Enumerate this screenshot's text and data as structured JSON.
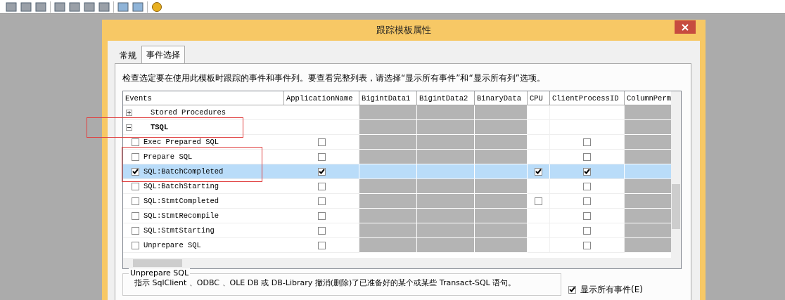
{
  "dialog": {
    "title": "跟踪模板属性"
  },
  "tabs": [
    {
      "label": "常规",
      "selected": false
    },
    {
      "label": "事件选择",
      "selected": true
    }
  ],
  "instructions": "检查选定要在使用此模板时跟踪的事件和事件列。要查看完整列表，请选择“显示所有事件”和“显示所有列”选项。",
  "grid": {
    "columns": [
      {
        "label": "Events"
      },
      {
        "label": "ApplicationName",
        "available": true
      },
      {
        "label": "BigintData1",
        "available": false
      },
      {
        "label": "BigintData2",
        "available": false
      },
      {
        "label": "BinaryData",
        "available": false
      },
      {
        "label": "CPU",
        "available": true
      },
      {
        "label": "ClientProcessID",
        "available": true
      },
      {
        "label": "ColumnPerm",
        "available": false
      }
    ],
    "rows": [
      {
        "kind": "category",
        "label": "Stored Procedures",
        "expanded": false,
        "selected": false,
        "framed": false,
        "cells": []
      },
      {
        "kind": "category",
        "label": "TSQL",
        "expanded": true,
        "selected": false,
        "framed": true,
        "cells": []
      },
      {
        "kind": "event",
        "label": "Exec Prepared SQL",
        "checked": false,
        "selected": false,
        "framed": false,
        "cells": [
          {
            "kind": "checkbox",
            "checked": false
          },
          {
            "kind": "none"
          },
          {
            "kind": "none"
          },
          {
            "kind": "none"
          },
          {
            "kind": "none"
          },
          {
            "kind": "checkbox",
            "checked": false
          },
          {
            "kind": "none"
          }
        ]
      },
      {
        "kind": "event",
        "label": "Prepare SQL",
        "checked": false,
        "selected": false,
        "framed": true,
        "cells": [
          {
            "kind": "checkbox",
            "checked": false
          },
          {
            "kind": "none"
          },
          {
            "kind": "none"
          },
          {
            "kind": "none"
          },
          {
            "kind": "none"
          },
          {
            "kind": "checkbox",
            "checked": false
          },
          {
            "kind": "none"
          }
        ]
      },
      {
        "kind": "event",
        "label": "SQL:BatchCompleted",
        "checked": true,
        "selected": true,
        "framed": true,
        "cells": [
          {
            "kind": "checkbox",
            "checked": true
          },
          {
            "kind": "none"
          },
          {
            "kind": "none"
          },
          {
            "kind": "none"
          },
          {
            "kind": "checkbox",
            "checked": true
          },
          {
            "kind": "checkbox",
            "checked": true
          },
          {
            "kind": "none"
          }
        ]
      },
      {
        "kind": "event",
        "label": "SQL:BatchStarting",
        "checked": false,
        "selected": false,
        "framed": false,
        "cells": [
          {
            "kind": "checkbox",
            "checked": false
          },
          {
            "kind": "none"
          },
          {
            "kind": "none"
          },
          {
            "kind": "none"
          },
          {
            "kind": "none"
          },
          {
            "kind": "checkbox",
            "checked": false
          },
          {
            "kind": "none"
          }
        ]
      },
      {
        "kind": "event",
        "label": "SQL:StmtCompleted",
        "checked": false,
        "selected": false,
        "framed": false,
        "cells": [
          {
            "kind": "checkbox",
            "checked": false
          },
          {
            "kind": "none"
          },
          {
            "kind": "none"
          },
          {
            "kind": "none"
          },
          {
            "kind": "checkbox",
            "checked": false
          },
          {
            "kind": "checkbox",
            "checked": false
          },
          {
            "kind": "none"
          }
        ]
      },
      {
        "kind": "event",
        "label": "SQL:StmtRecompile",
        "checked": false,
        "selected": false,
        "framed": false,
        "cells": [
          {
            "kind": "checkbox",
            "checked": false
          },
          {
            "kind": "none"
          },
          {
            "kind": "none"
          },
          {
            "kind": "none"
          },
          {
            "kind": "none"
          },
          {
            "kind": "checkbox",
            "checked": false
          },
          {
            "kind": "none"
          }
        ]
      },
      {
        "kind": "event",
        "label": "SQL:StmtStarting",
        "checked": false,
        "selected": false,
        "framed": false,
        "cells": [
          {
            "kind": "checkbox",
            "checked": false
          },
          {
            "kind": "none"
          },
          {
            "kind": "none"
          },
          {
            "kind": "none"
          },
          {
            "kind": "none"
          },
          {
            "kind": "checkbox",
            "checked": false
          },
          {
            "kind": "none"
          }
        ]
      },
      {
        "kind": "event",
        "label": "Unprepare SQL",
        "checked": false,
        "selected": false,
        "framed": false,
        "cells": [
          {
            "kind": "checkbox",
            "checked": false
          },
          {
            "kind": "none"
          },
          {
            "kind": "none"
          },
          {
            "kind": "none"
          },
          {
            "kind": "none"
          },
          {
            "kind": "checkbox",
            "checked": false
          },
          {
            "kind": "none"
          }
        ]
      }
    ]
  },
  "description": {
    "title": "Unprepare SQL",
    "text": "指示 SqlClient 、ODBC 、OLE DB 或 DB-Library 撤消(删除)了已准备好的某个或某些 Transact-SQL 语句。"
  },
  "show_all_events": {
    "label": "显示所有事件(E)",
    "checked": true
  }
}
